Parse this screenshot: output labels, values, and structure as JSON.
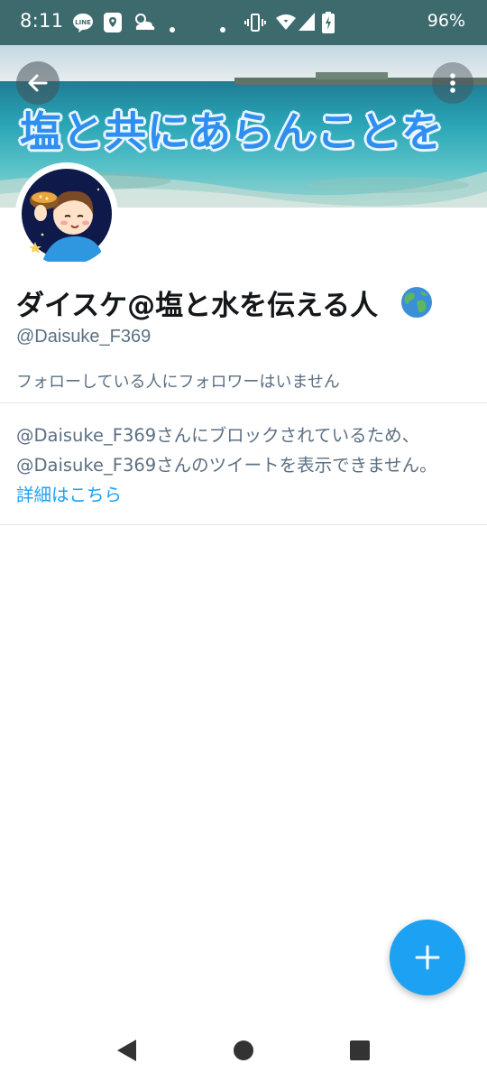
{
  "status_bar": {
    "time": "8:11",
    "line_label": "LINE",
    "battery": "96%",
    "background": "#3d6b6d"
  },
  "banner": {
    "title": "塩と共にあらんことを",
    "back_icon": "arrow-left-icon",
    "more_icon": "more-vertical-icon"
  },
  "profile": {
    "display_name": "ダイスケ@塩と水を伝える人",
    "emoji_icon": "globe-icon",
    "handle": "@Daisuke_F369",
    "follow_note": "フォローしている人にフォロワーはいません"
  },
  "blocked": {
    "line1": "@Daisuke_F369さんにブロックされているため、",
    "line2": "@Daisuke_F369さんのツイートを表示できません。",
    "learn_more": "詳細はこちら"
  },
  "fab": {
    "icon": "plus-icon",
    "color": "#1da1f2"
  },
  "nav": {
    "back_icon": "nav-back-icon",
    "home_icon": "nav-home-icon",
    "recents_icon": "nav-recents-icon"
  }
}
